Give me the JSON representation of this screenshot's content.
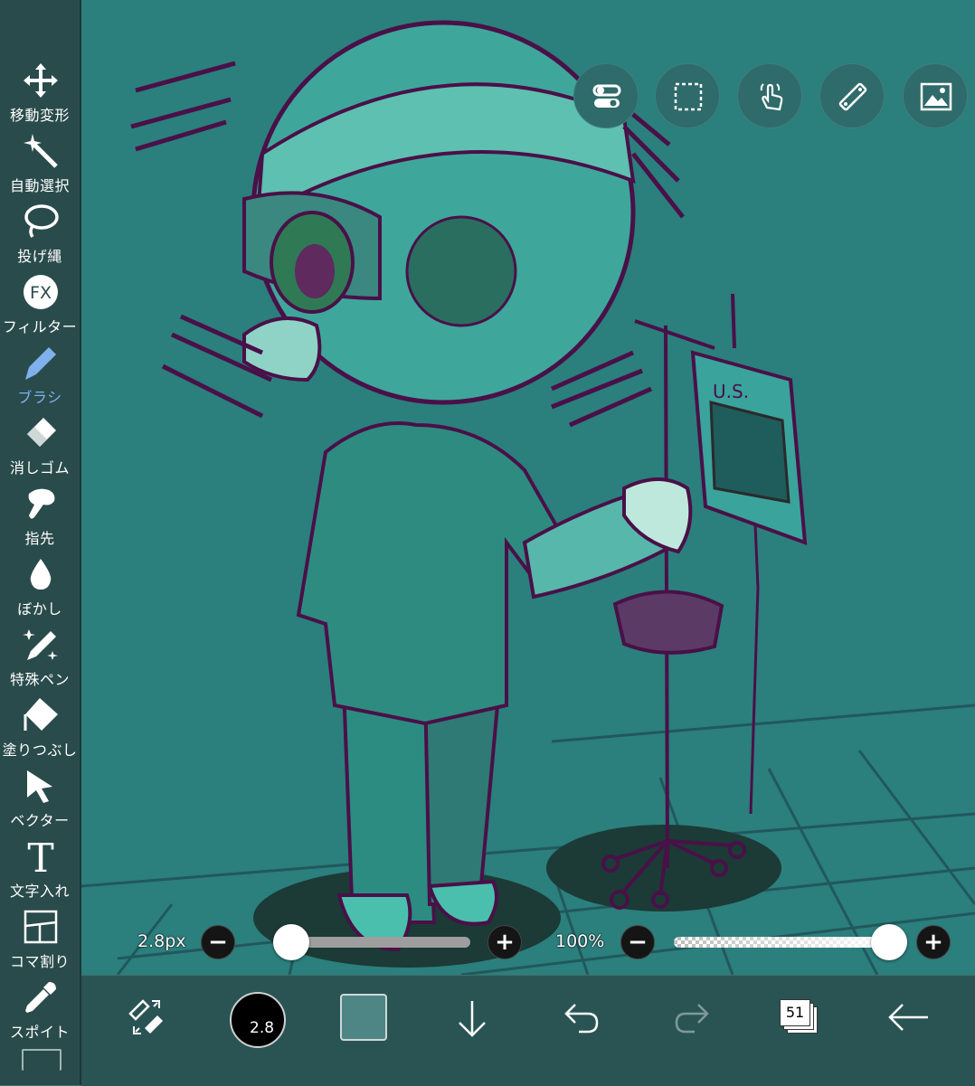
{
  "colors": {
    "sidebar_bg": "#2a4b4b",
    "canvas_bg": "#2b7f7d",
    "bottombar_bg": "#2a5454",
    "active_tool": "#7fb1ee",
    "current_color": "#4e8585"
  },
  "sidebar": {
    "tools": [
      {
        "label": "移動変形",
        "icon": "move-transform-icon",
        "active": false
      },
      {
        "label": "自動選択",
        "icon": "magic-wand-icon",
        "active": false
      },
      {
        "label": "投げ縄",
        "icon": "lasso-icon",
        "active": false
      },
      {
        "label": "フィルター",
        "icon": "fx-filter-icon",
        "active": false
      },
      {
        "label": "ブラシ",
        "icon": "brush-icon",
        "active": true
      },
      {
        "label": "消しゴム",
        "icon": "eraser-icon",
        "active": false
      },
      {
        "label": "指先",
        "icon": "finger-smudge-icon",
        "active": false
      },
      {
        "label": "ぼかし",
        "icon": "blur-drop-icon",
        "active": false
      },
      {
        "label": "特殊ペン",
        "icon": "special-pen-icon",
        "active": false
      },
      {
        "label": "塗りつぶし",
        "icon": "fill-bucket-icon",
        "active": false
      },
      {
        "label": "ベクター",
        "icon": "vector-arrow-icon",
        "active": false
      },
      {
        "label": "文字入れ",
        "icon": "text-icon",
        "active": false
      },
      {
        "label": "コマ割り",
        "icon": "panel-split-icon",
        "active": false
      },
      {
        "label": "スポイト",
        "icon": "eyedropper-icon",
        "active": false
      }
    ]
  },
  "canvas_toolbar": {
    "buttons": [
      {
        "icon": "toggle-settings-icon"
      },
      {
        "icon": "selection-marquee-icon"
      },
      {
        "icon": "hand-touch-icon"
      },
      {
        "icon": "ruler-icon"
      },
      {
        "icon": "image-icon"
      }
    ]
  },
  "brush_size": {
    "label": "2.8px",
    "minus": "−",
    "plus": "+",
    "fraction": 0.0
  },
  "opacity": {
    "label": "100%",
    "minus": "−",
    "plus": "+",
    "fraction": 1.0
  },
  "bottombar": {
    "swap_icon": "swap-brush-eraser-icon",
    "brush_size_value": "2.8",
    "download_icon": "arrow-down-icon",
    "undo_icon": "undo-icon",
    "redo_icon": "redo-icon",
    "layer_count": "51",
    "back_icon": "back-arrow-icon"
  }
}
